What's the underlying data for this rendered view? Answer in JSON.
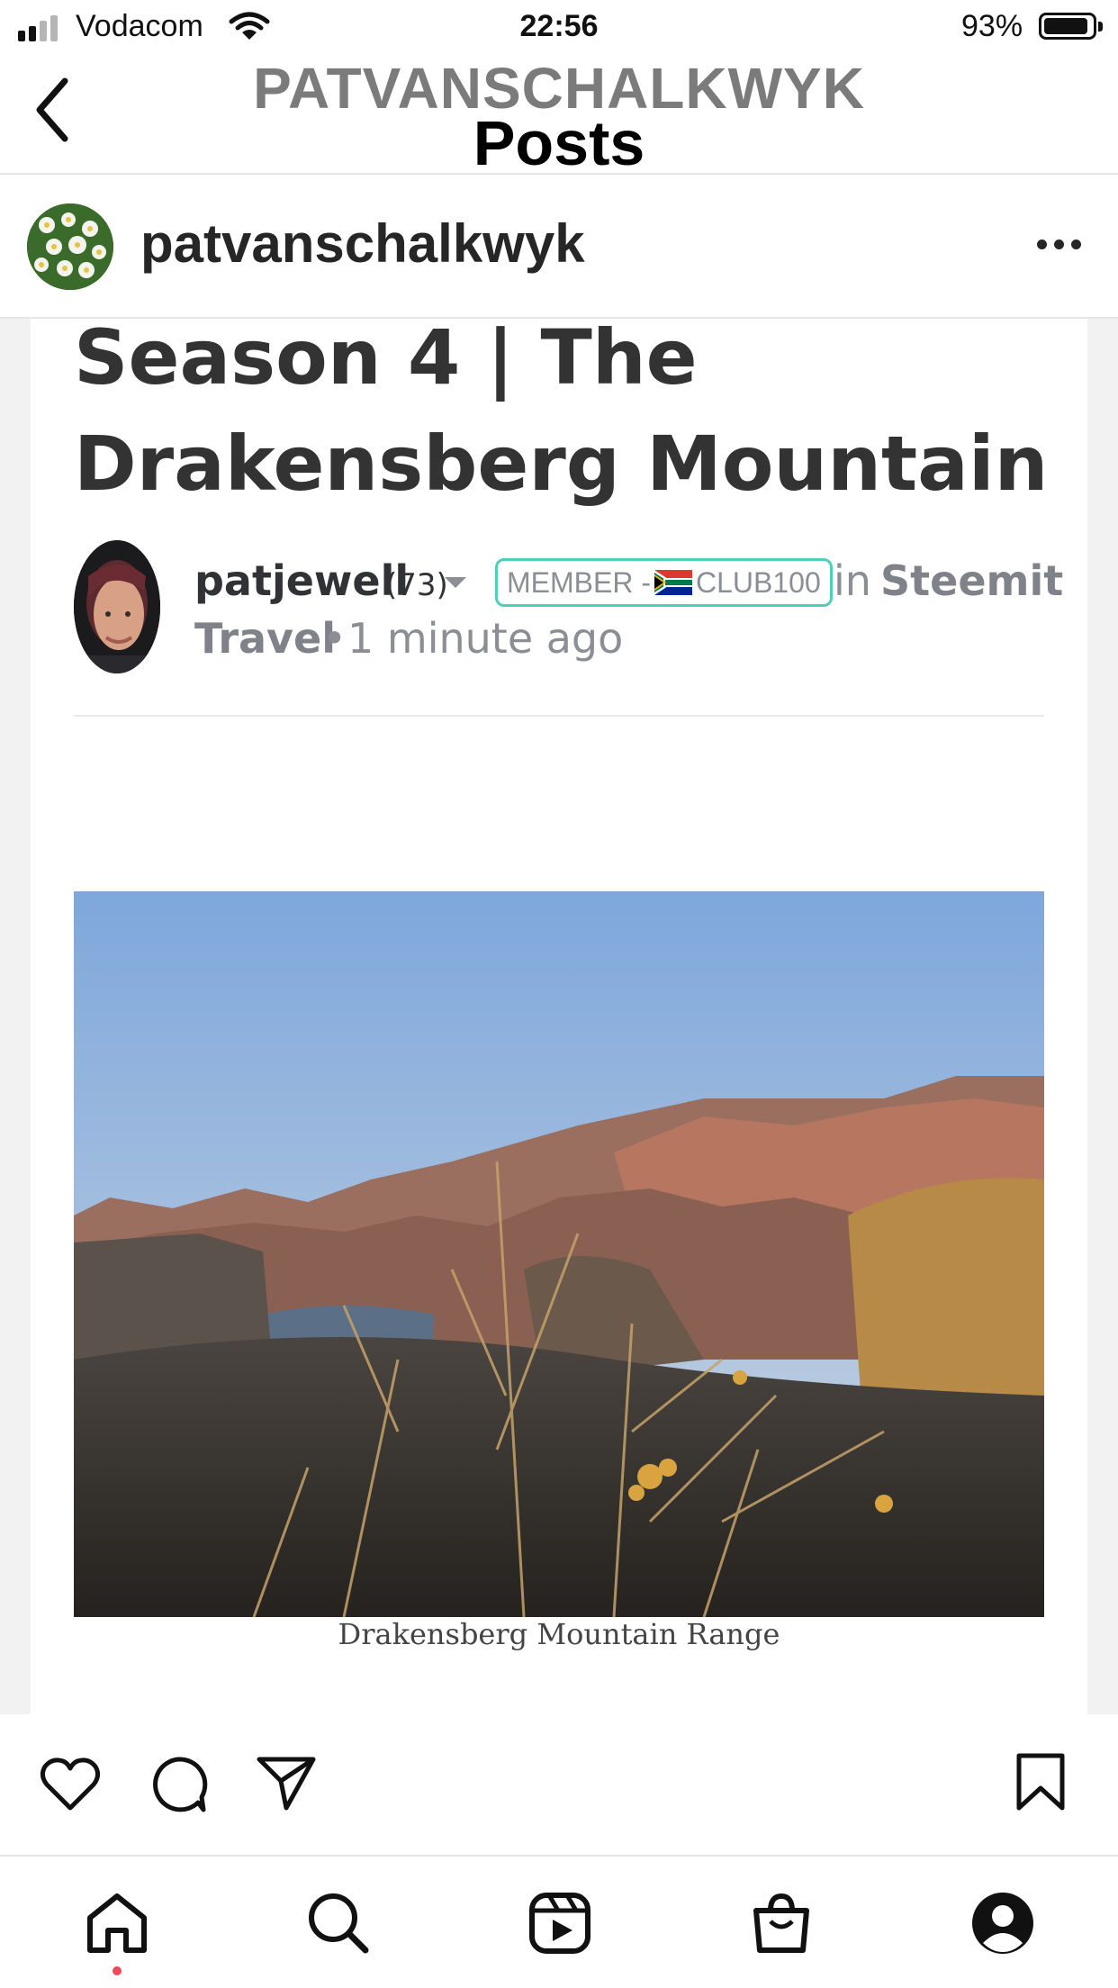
{
  "status_bar": {
    "carrier": "Vodacom",
    "time": "22:56",
    "battery_percent": "93%",
    "battery_level": 0.93,
    "signal_bars": 2
  },
  "nav": {
    "title": "PATVANSCHALKWYK",
    "subtitle": "Posts"
  },
  "post": {
    "username": "patvanschalkwyk",
    "article": {
      "title_lines": [
        "Season 4 | The",
        "Drakensberg Mountain"
      ],
      "author": "patjewell",
      "reputation": "(73)",
      "badge": {
        "prefix": "MEMBER - ",
        "club": "CLUB100"
      },
      "in_label": "in",
      "community_part1": "Steemit",
      "community_part2": "Travel",
      "separator": "•",
      "time_ago": "1 minute ago",
      "image_caption": "Drakensberg Mountain Range"
    }
  },
  "icons": {
    "back": "chevron-left-icon",
    "more": "more-icon",
    "like": "heart-icon",
    "comment": "comment-icon",
    "share": "send-icon",
    "save": "bookmark-icon",
    "tabs": [
      "home-icon",
      "search-icon",
      "reels-icon",
      "shop-icon",
      "profile-icon"
    ]
  },
  "colors": {
    "badge_border": "#4ecfb7",
    "notification_dot": "#ed4956"
  }
}
